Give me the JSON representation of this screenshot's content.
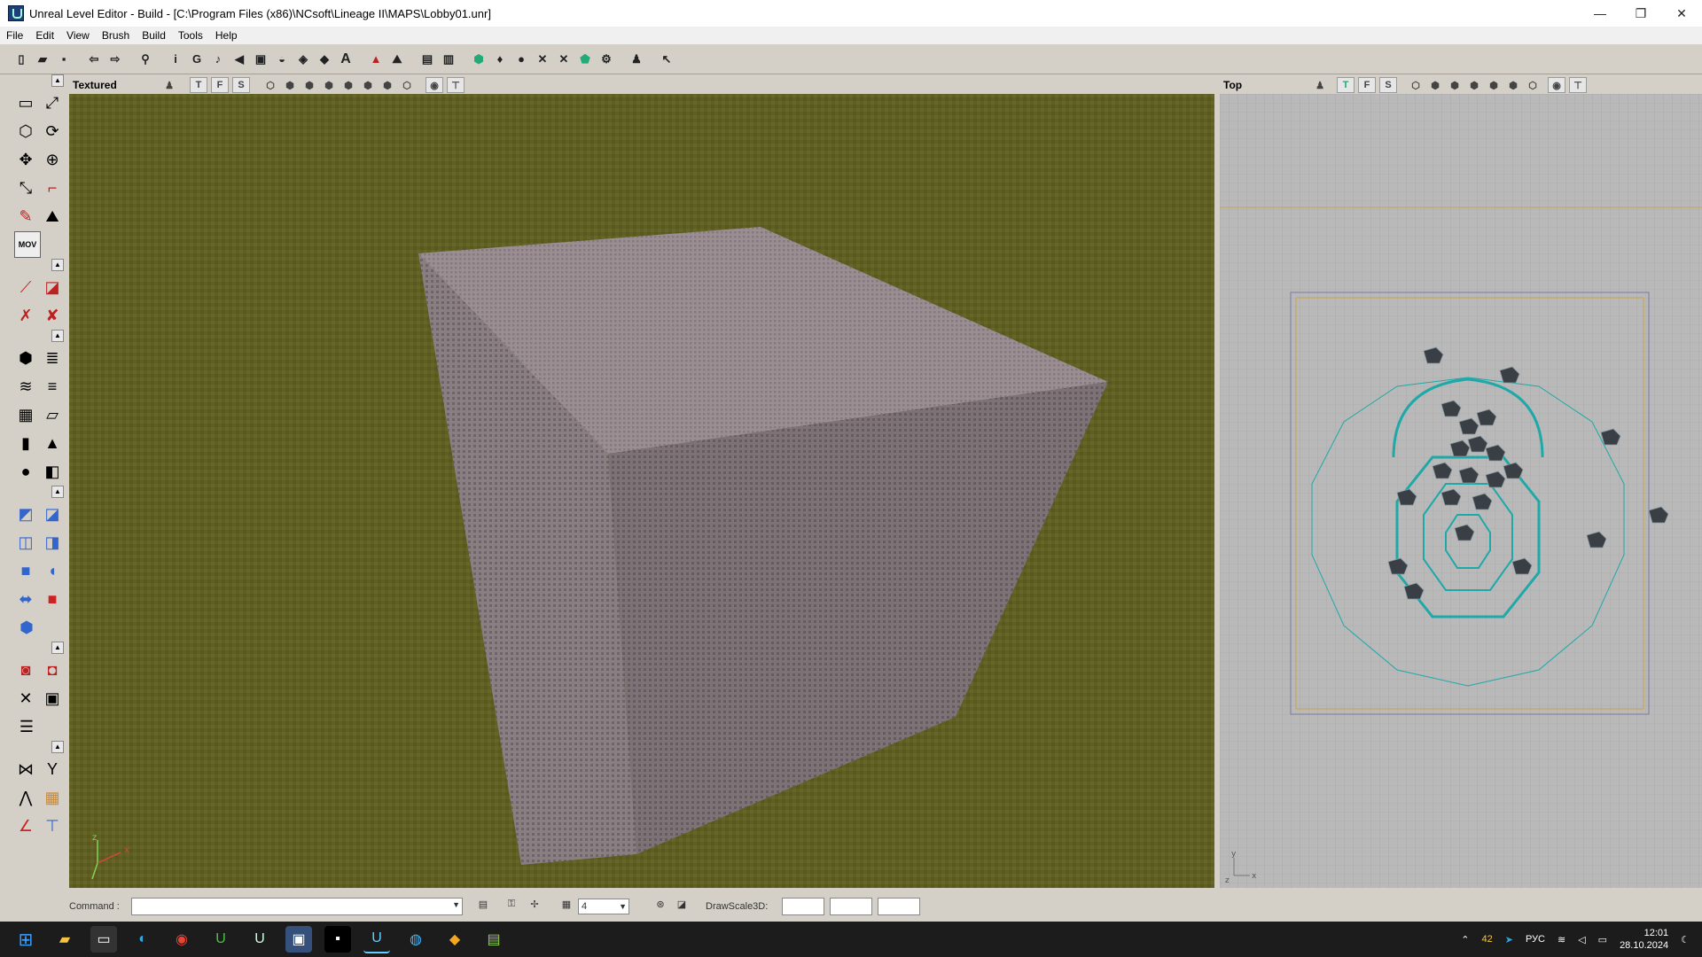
{
  "window": {
    "title": "Unreal Level Editor - Build  - [C:\\Program Files (x86)\\NCsoft\\Lineage II\\MAPS\\Lobby01.unr]",
    "minimize": "—",
    "maximize": "❐",
    "close": "✕"
  },
  "menu": [
    "File",
    "Edit",
    "View",
    "Brush",
    "Build",
    "Tools",
    "Help"
  ],
  "toolbar": {
    "icons": [
      "new-icon",
      "open-icon",
      "save-icon",
      "undo-icon",
      "redo-icon",
      "find-icon",
      "info-icon",
      "goto-icon",
      "actor-icon",
      "sound-icon",
      "texture-icon",
      "mesh-icon",
      "animation-icon",
      "static-mesh-icon",
      "font-icon",
      "red-triangle-icon",
      "terrain-icon",
      "browser-icon",
      "level-icon",
      "shield-icon",
      "light-icon",
      "bulb-icon",
      "path-icon",
      "tunnel-icon",
      "camera-icon",
      "build-icon",
      "actor-select-icon",
      "pointer-icon"
    ]
  },
  "leftpanel": {
    "sections": [
      [
        "camera-move-icon",
        "vertex-edit-icon",
        "brush-clip-icon",
        "rotate-icon",
        "move-icon",
        "scale-icon",
        "texture-pan-icon",
        "texture-rotate-icon",
        "brush-icon",
        "polygon-icon",
        "mov-icon"
      ],
      [
        "red-line-icon",
        "red-square-icon",
        "pointer-x-icon",
        "wrench-icon"
      ],
      [
        "cube-icon",
        "stairs-icon",
        "curved-stairs-icon",
        "spiral-stairs-icon",
        "sheet-icon",
        "plane-icon",
        "cylinder-icon",
        "cone-icon",
        "sphere-icon",
        "tetrahedron-icon"
      ],
      [
        "add-icon",
        "subtract-icon",
        "intersect-icon",
        "deintersect-icon",
        "blue-square-icon",
        "mover-icon",
        "semisolid-icon",
        "red-box-icon",
        "mesh-box-icon"
      ],
      [
        "hide-icon",
        "show-icon",
        "filter-icon",
        "grid-icon",
        "align-icon"
      ],
      [
        "snap-icon",
        "pivot-icon",
        "mirror-icon",
        "color-icon",
        "red-a-icon",
        "tools-icon"
      ]
    ],
    "mov_label": "MOV"
  },
  "viewport3d": {
    "title": "Textured",
    "buttons": [
      "T",
      "F",
      "S"
    ],
    "colors": {
      "ground": "#5f5f22",
      "box_front": "#8a7e82",
      "box_top": "#9a8e92",
      "box_side": "#7e7276"
    },
    "axis": {
      "x": "x",
      "z": "z"
    }
  },
  "viewportTop": {
    "title": "Top",
    "buttons": [
      "T",
      "F",
      "S"
    ],
    "colors": {
      "bg": "#b9b9b9",
      "wire": "#1fa8a8",
      "bounds": "#7a7aa0",
      "gold": "#c8a030"
    },
    "axis": {
      "x": "x",
      "y": "y",
      "z": "z"
    }
  },
  "statusbar": {
    "command_label": "Command :",
    "command_value": "",
    "grid_value": "4",
    "drawscale_label": "DrawScale3D:",
    "drawscale_values": [
      "",
      "",
      ""
    ]
  },
  "taskbar": {
    "apps": [
      "windows-start-icon",
      "explorer-icon",
      "terminal-icon",
      "edge-icon",
      "chrome-icon",
      "unreal-green-icon",
      "unreal-icon",
      "unreal-dark-icon",
      "unreal-black-icon",
      "unreal-active-icon",
      "browser-icon",
      "app-orange-icon",
      "notepad-icon"
    ],
    "tray": {
      "temp": "42",
      "lang": "РУС",
      "time": "12:01",
      "date": "28.10.2024"
    }
  }
}
